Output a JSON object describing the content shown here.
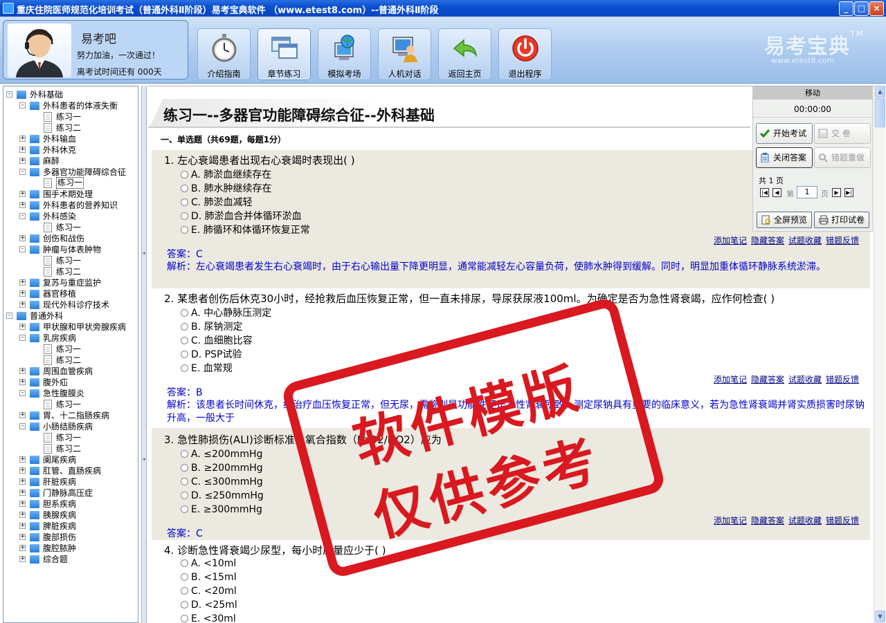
{
  "window": {
    "title": "重庆住院医师规范化培训考试（普通外科Ⅱ阶段）易考宝典软件 （www.etest8.com）--普通外科Ⅱ阶段",
    "controls": [
      "_",
      "□",
      "×"
    ]
  },
  "header": {
    "user_name": "易考吧",
    "motto": "努力加油，一次通过！",
    "countdown": "离考试时间还有 000天",
    "toolbar": [
      {
        "label": "介绍指南",
        "icon": "stopwatch-icon"
      },
      {
        "label": "章节练习",
        "icon": "windows-icon"
      },
      {
        "label": "模拟考场",
        "icon": "globe-computer-icon"
      },
      {
        "label": "人机对话",
        "icon": "user-computer-icon"
      },
      {
        "label": "返回主页",
        "icon": "back-arrow-icon"
      },
      {
        "label": "退出程序",
        "icon": "power-icon"
      }
    ],
    "brand": "易考宝典",
    "brand_tm": "TM",
    "brand_url": "www.etest8.com"
  },
  "tree": [
    {
      "label": "外科基础",
      "level": 0,
      "kind": "folder",
      "exp": "-"
    },
    {
      "label": "外科患者的体液失衡",
      "level": 1,
      "kind": "folder",
      "exp": "-"
    },
    {
      "label": "练习一",
      "level": 2,
      "kind": "doc"
    },
    {
      "label": "练习二",
      "level": 2,
      "kind": "doc"
    },
    {
      "label": "外科输血",
      "level": 1,
      "kind": "folder",
      "exp": "+"
    },
    {
      "label": "外科休克",
      "level": 1,
      "kind": "folder",
      "exp": "+"
    },
    {
      "label": "麻醉",
      "level": 1,
      "kind": "folder",
      "exp": "+"
    },
    {
      "label": "多器官功能障碍综合征",
      "level": 1,
      "kind": "folder",
      "exp": "-"
    },
    {
      "label": "练习一",
      "level": 2,
      "kind": "doc",
      "selected": true
    },
    {
      "label": "围手术期处理",
      "level": 1,
      "kind": "folder",
      "exp": "+"
    },
    {
      "label": "外科患者的营养知识",
      "level": 1,
      "kind": "folder",
      "exp": "+"
    },
    {
      "label": "外科感染",
      "level": 1,
      "kind": "folder",
      "exp": "-"
    },
    {
      "label": "练习一",
      "level": 2,
      "kind": "doc"
    },
    {
      "label": "创伤和战伤",
      "level": 1,
      "kind": "folder",
      "exp": "+"
    },
    {
      "label": "肿瘤与体表肿物",
      "level": 1,
      "kind": "folder",
      "exp": "-"
    },
    {
      "label": "练习一",
      "level": 2,
      "kind": "doc"
    },
    {
      "label": "练习二",
      "level": 2,
      "kind": "doc"
    },
    {
      "label": "复苏与重症监护",
      "level": 1,
      "kind": "folder",
      "exp": "+"
    },
    {
      "label": "器官移植",
      "level": 1,
      "kind": "folder",
      "exp": "+"
    },
    {
      "label": "现代外科诊疗技术",
      "level": 1,
      "kind": "folder",
      "exp": "+"
    },
    {
      "label": "普通外科",
      "level": 0,
      "kind": "folder",
      "exp": "-"
    },
    {
      "label": "甲状腺和甲状旁腺疾病",
      "level": 1,
      "kind": "folder",
      "exp": "+"
    },
    {
      "label": "乳房疾病",
      "level": 1,
      "kind": "folder",
      "exp": "-"
    },
    {
      "label": "练习一",
      "level": 2,
      "kind": "doc"
    },
    {
      "label": "练习二",
      "level": 2,
      "kind": "doc"
    },
    {
      "label": "周围血管疾病",
      "level": 1,
      "kind": "folder",
      "exp": "+"
    },
    {
      "label": "腹外疝",
      "level": 1,
      "kind": "folder",
      "exp": "+"
    },
    {
      "label": "急性腹膜炎",
      "level": 1,
      "kind": "folder",
      "exp": "-"
    },
    {
      "label": "练习一",
      "level": 2,
      "kind": "doc"
    },
    {
      "label": "胃、十二指肠疾病",
      "level": 1,
      "kind": "folder",
      "exp": "+"
    },
    {
      "label": "小肠结肠疾病",
      "level": 1,
      "kind": "folder",
      "exp": "-"
    },
    {
      "label": "练习一",
      "level": 2,
      "kind": "doc"
    },
    {
      "label": "练习二",
      "level": 2,
      "kind": "doc"
    },
    {
      "label": "阑尾疾病",
      "level": 1,
      "kind": "folder",
      "exp": "+"
    },
    {
      "label": "肛管、直肠疾病",
      "level": 1,
      "kind": "folder",
      "exp": "+"
    },
    {
      "label": "肝脏疾病",
      "level": 1,
      "kind": "folder",
      "exp": "+"
    },
    {
      "label": "门静脉高压症",
      "level": 1,
      "kind": "folder",
      "exp": "+"
    },
    {
      "label": "胆系疾病",
      "level": 1,
      "kind": "folder",
      "exp": "+"
    },
    {
      "label": "胰腺疾病",
      "level": 1,
      "kind": "folder",
      "exp": "+"
    },
    {
      "label": "脾脏疾病",
      "level": 1,
      "kind": "folder",
      "exp": "+"
    },
    {
      "label": "腹部损伤",
      "level": 1,
      "kind": "folder",
      "exp": "+"
    },
    {
      "label": "腹腔脓肿",
      "level": 1,
      "kind": "folder",
      "exp": "+"
    },
    {
      "label": "综合题",
      "level": 1,
      "kind": "folder",
      "exp": "+"
    }
  ],
  "main": {
    "title": "练习一--多器官功能障碍综合征--外科基础",
    "section": "一、单选题（共69题，每题1分）",
    "links": [
      "添加笔记",
      "隐藏答案",
      "试题收藏",
      "错题反馈"
    ],
    "questions": [
      {
        "text": "1. 左心衰竭患者出现右心衰竭时表现出(  )",
        "options": [
          "A. 肺淤血继续存在",
          "B. 肺水肿继续存在",
          "C. 肺淤血减轻",
          "D. 肺淤血合并体循环淤血",
          "E. 肺循环和体循环恢复正常"
        ],
        "answer": "答案：C",
        "analysis": "解析：左心衰竭患者发生右心衰竭时，由于右心输出量下降更明显，通常能减轻左心容量负荷，使肺水肿得到缓解。同时，明显加重体循环静脉系统淤滞。"
      },
      {
        "text": "2. 某患者创伤后休克30小时，经抢救后血压恢复正常，但一直未排尿，导尿获尿液100ml。为确定是否为急性肾衰竭，应作何检查(  )",
        "options": [
          "A. 中心静脉压测定",
          "B. 尿钠测定",
          "C. 血细胞比容",
          "D. PSP试验",
          "E. 血常规"
        ],
        "answer": "答案：B",
        "analysis": "解析：该患者长时间休克，经治疗血压恢复正常，但无尿，需鉴别是功能性还是急性肾衰所致。测定尿钠具有重要的临床意义，若为急性肾衰竭并肾实质损害时尿钠升高，一般大于"
      },
      {
        "text": "3. 急性肺损伤(ALI)诊断标准：氧合指数（PaO2/FiO2）应为",
        "options": [
          "A. ≤200mmHg",
          "B. ≥200mmHg",
          "C. ≤300mmHg",
          "D. ≤250mmHg",
          "E. ≥300mmHg"
        ],
        "answer": "答案：C"
      },
      {
        "text": "4. 诊断急性肾衰竭少尿型，每小时尿量应少于(  )",
        "options": [
          "A. <10ml",
          "B. <15ml",
          "C. <20ml",
          "D. <25ml",
          "E. <30ml"
        ]
      }
    ]
  },
  "control": {
    "move": "移动",
    "timer": "00:00:00",
    "start_exam": "开始考试",
    "submit": "交  卷",
    "close_answer": "关闭答案",
    "redo_wrong": "错题重做",
    "pages": "共 1 页",
    "page_prefix": "第",
    "page_value": "1",
    "page_suffix": "页",
    "fullscreen": "全屏预览",
    "print": "打印试卷"
  },
  "stamp": {
    "line1": "软件模版",
    "line2": "仅供参考"
  }
}
